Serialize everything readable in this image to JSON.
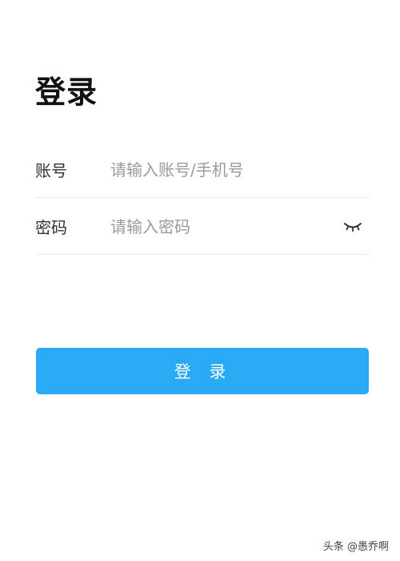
{
  "page": {
    "title": "登录"
  },
  "form": {
    "account": {
      "label": "账号",
      "placeholder": "请输入账号/手机号",
      "value": ""
    },
    "password": {
      "label": "密码",
      "placeholder": "请输入密码",
      "value": "",
      "visibility_icon": "eye-closed-icon"
    },
    "submit_label": "登 录"
  },
  "watermark": {
    "text": "头条 @愚乔啊"
  },
  "colors": {
    "accent": "#2aaaf5",
    "divider": "#ebebeb",
    "placeholder": "#9a9a9a"
  }
}
